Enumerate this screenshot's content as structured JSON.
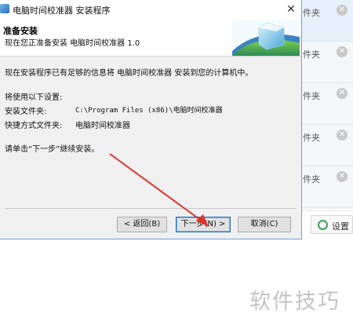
{
  "window": {
    "title": "电脑时间校准器 安装程序",
    "close_glyph": "✕"
  },
  "header": {
    "title": "准备安装",
    "subtitle": "现在您正准备安装 电脑时间校准器 1.0"
  },
  "body": {
    "intro": "现在安装程序已有足够的信息将 电脑时间校准器 安装到您的计算机中。",
    "settings_heading": "将使用以下设置:",
    "install_folder_label": "安装文件夹:",
    "install_folder_value": "C:\\Program Files (x86)\\电脑时间校准器",
    "shortcut_folder_label": "快捷方式文件夹:",
    "shortcut_folder_value": "电脑时间校准器",
    "instruction": "请单击“下一步”继续安装。"
  },
  "buttons": {
    "back": "< 返回(B)",
    "next": "下一步(N) >",
    "cancel": "取消(C)"
  },
  "background_list": {
    "rows": [
      {
        "text": "件夹",
        "highlight": true
      },
      {
        "text": "件夹",
        "highlight": false
      },
      {
        "text": "件夹",
        "highlight": false
      },
      {
        "text": "件夹",
        "highlight": false
      },
      {
        "text": "件夹",
        "highlight": false
      }
    ],
    "close_glyph": "✕",
    "settings_label": "设置"
  },
  "watermark": "软件技巧",
  "colors": {
    "accent": "#1f6fc4",
    "arrow": "#e0332b"
  }
}
